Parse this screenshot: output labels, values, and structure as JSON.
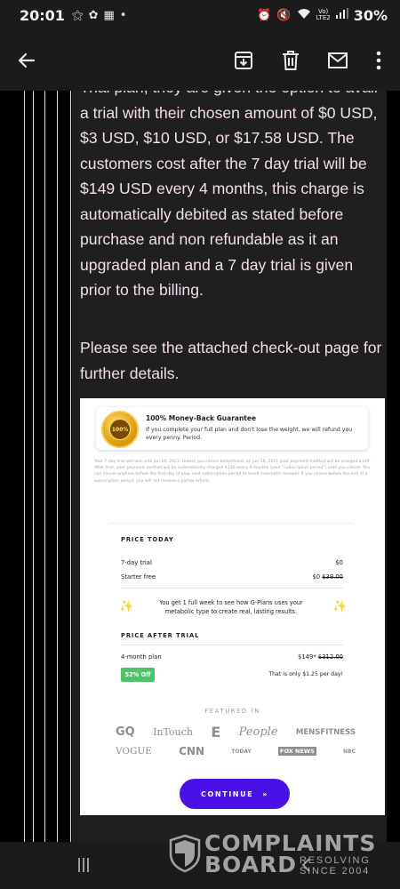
{
  "status_bar": {
    "time": "20:01",
    "battery": "30%",
    "network_top": "Vo)",
    "network_bottom": "LTE2"
  },
  "toolbar": {
    "back_icon": "arrow-left-icon",
    "archive_icon": "archive-download-icon",
    "delete_icon": "trash-icon",
    "mark_unread_icon": "envelope-icon",
    "more_icon": "more-vert-icon"
  },
  "email": {
    "paragraph1": "Trial plan, they are given the option to avail a trial with their chosen amount of $0 USD, $3 USD, $10 USD, or $17.58 USD. The customers cost after the 7 day trial will be $149 USD every 4 months, this charge is automatically debited as stated before purchase and non refundable as it an upgraded plan and a 7 day trial is given prior to the billing.",
    "paragraph2": "Please see the attached check-out page for further details."
  },
  "checkout": {
    "guarantee_badge": "100%",
    "guarantee_title": "100% Money-Back Guarantee",
    "guarantee_desc": "If you complete your full plan and don't lose the weight, we will refund you every penny. Period.",
    "fine_print": "Your 7-day trial will last until Jun 16, 2021. Unless you cancel beforehand, on Jun 16, 2021 your payment method will be charged $149. After that, your payment method will be automatically charged $149 every 4 months (your \"subscription period\") until you cancel. You can cancel anytime before the first day of your next subscription period to avoid automatic renewal. If you cancel before the end of a subscription period, you will not receive a partial refund.",
    "price_today_label": "PRICE TODAY",
    "trial_label": "7-day trial",
    "trial_value": "$0",
    "starter_label": "Starter free",
    "starter_value": "$0",
    "starter_old_value": "$39.00",
    "week_note": "You get 1 full week to see how G-Plans uses your metabolic type to create real, lasting results.",
    "price_after_label": "PRICE AFTER TRIAL",
    "plan_label": "4-month plan",
    "plan_value": "$149*",
    "plan_old_value": "$312.00",
    "discount_badge": "52% Off",
    "per_day": "That is only $1.25 per day!",
    "featured_label": "FEATURED IN",
    "logos_row1": [
      "GQ",
      "InTouch",
      "E",
      "People",
      "MENSFITNESS"
    ],
    "logos_row2": [
      "VOGUE",
      "CNN",
      "TODAY",
      "FOX NEWS",
      "NBC"
    ],
    "continue_label": "CONTINUE",
    "continue_arrow": "»"
  },
  "watermark": {
    "line1": "COMPLAINTS",
    "line2": "BOARD",
    "tag1": "RESOLVING",
    "tag2": "SINCE 2004"
  },
  "colors": {
    "email_text": "#f1ddeb",
    "continue_button": "#4a10e8",
    "discount_badge": "#4ec46a"
  }
}
